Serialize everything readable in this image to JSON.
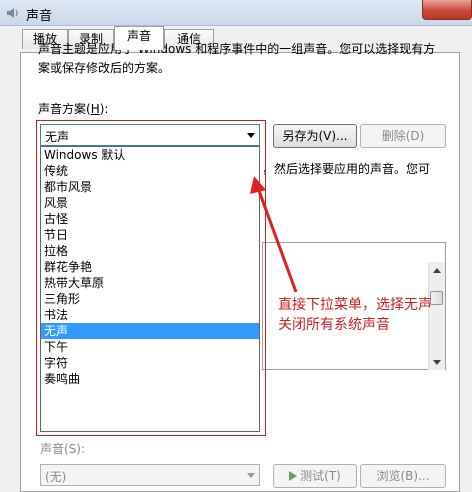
{
  "window": {
    "title": "声音",
    "icon": "speaker-icon"
  },
  "tabs": [
    {
      "label": "播放",
      "active": false
    },
    {
      "label": "录制",
      "active": false
    },
    {
      "label": "声音",
      "active": true
    },
    {
      "label": "通信",
      "active": false
    }
  ],
  "panel": {
    "description": "声音主题是应用于 Windows 和程序事件中的一组声音。您可以选择现有方案或保存修改后的方案。",
    "scheme_label_prefix": "声音方案(",
    "scheme_label_key": "H",
    "scheme_label_suffix": "):",
    "scheme_selected": "无声",
    "save_as_label": "另存为(V)...",
    "delete_label": "删除(D)",
    "partial_text": "，然后选择要应用的声音。您可",
    "sound_label": "声音(S):",
    "sound_value": "(无)",
    "test_label": "测试(T)",
    "browse_label": "浏览(B)..."
  },
  "dropdown": {
    "items": [
      "Windows 默认",
      "传统",
      "都市风景",
      "风景",
      "古怪",
      "节日",
      "拉格",
      "群花争艳",
      "热带大草原",
      "三角形",
      "书法",
      "无声",
      "下午",
      "字符",
      "奏鸣曲"
    ],
    "selected_index": 11
  },
  "annotation": {
    "text": "直接下拉菜单，选择无声关闭所有系统声音",
    "color": "#cc1f1f"
  }
}
